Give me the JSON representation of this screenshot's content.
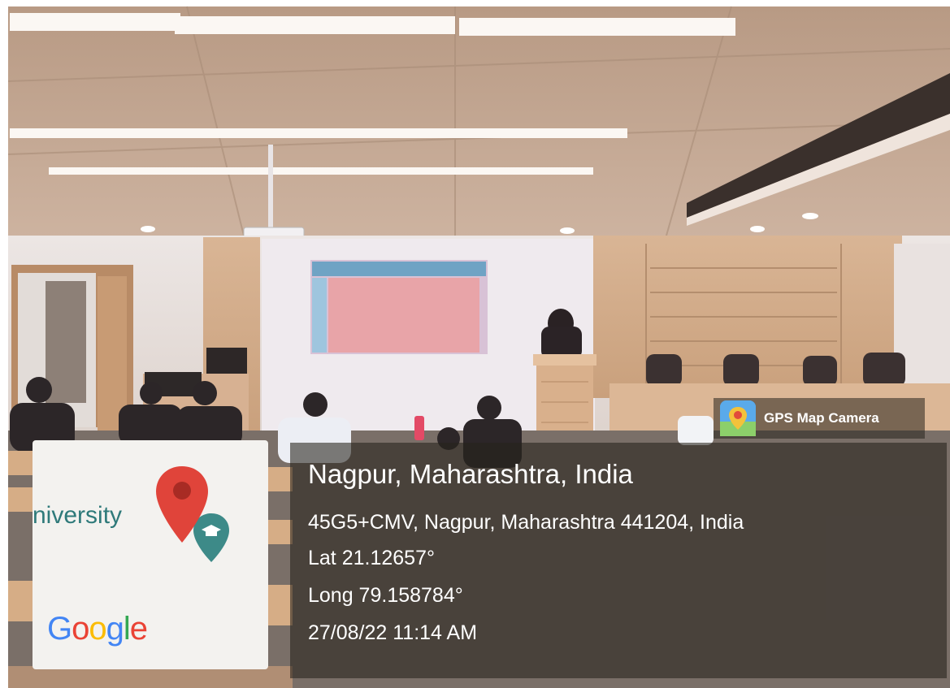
{
  "gps_badge": {
    "app_name": "GPS Map Camera",
    "icon": "map-pin-icon"
  },
  "location": {
    "city_line": "Nagpur, Maharashtra, India",
    "address": "45G5+CMV, Nagpur, Maharashtra 441204, India",
    "latitude": "Lat 21.12657°",
    "longitude": "Long 79.158784°",
    "datetime": "27/08/22 11:14 AM"
  },
  "map_thumbnail": {
    "place_label": "niversity",
    "provider_logo": "Google",
    "pins": [
      "red-location-pin-icon",
      "teal-education-pin-icon"
    ]
  },
  "colors": {
    "pin_red": "#e0443a",
    "pin_teal": "#3d8a88",
    "overlay": "#26221c",
    "google_blue": "#4285f4",
    "google_red": "#ea4335",
    "google_yellow": "#fbbc05",
    "google_green": "#34a853"
  }
}
